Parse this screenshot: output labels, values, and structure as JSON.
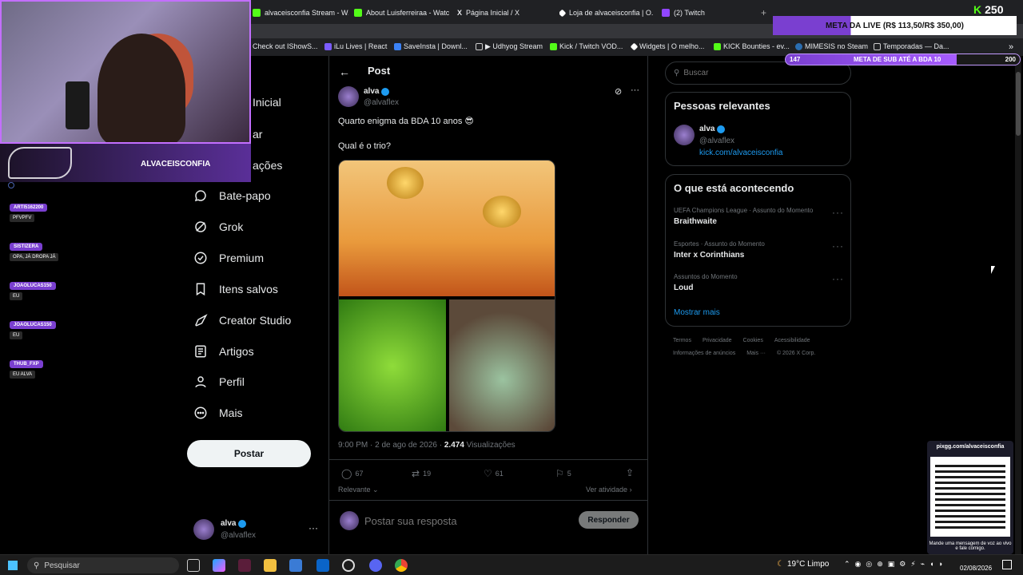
{
  "browser": {
    "tabs": [
      {
        "label": "alvaceisconfia Stream - W...",
        "color": "#53fc18"
      },
      {
        "label": "About Luisferreiraa - Watc...",
        "color": "#53fc18"
      },
      {
        "label": "Página Inicial / X",
        "color": "#ffffff"
      },
      {
        "label": "Loja de alvaceisconfia | O...",
        "color": "#ffffff"
      },
      {
        "label": "(2) Twitch",
        "color": "#9146ff"
      }
    ],
    "new_tab": "+",
    "bookmarks": [
      "Check out IShowS...",
      "iLu Lives | React",
      "SaveInsta | Downl...",
      "▶ Udhyog Stream",
      "Kick / Twitch VOD...",
      "Widgets | O melho...",
      "KICK Bounties - ev...",
      "MIMESIS no Steam",
      "Temporadas — Da..."
    ]
  },
  "overlay": {
    "kick_count": "250",
    "meta_live": "META DA LIVE (R$ 113,50/R$ 350,00)",
    "sub_left": "147",
    "sub_goal": "META DE SUB ATÉ A BDA 10",
    "sub_right": "200",
    "streamer_name": "ALVACEISCONFIA",
    "chat": [
      {
        "user": "ARTI5162200",
        "msg": "PFVPFV"
      },
      {
        "user": "SISTIZERA",
        "msg": "OPA, JÁ DROPA JÁ"
      },
      {
        "user": "JOAOLUCAS150",
        "msg": "EU"
      },
      {
        "user": "JOAOLUCAS150",
        "msg": "EU"
      },
      {
        "user": "THUB_FXP",
        "msg": "EU ALVA"
      }
    ],
    "pix_url": "pixgg.com/alvaceisconfia",
    "pix_caption": "Mande uma mensagem de voz ao vivo e fale comigo."
  },
  "nav": {
    "items": [
      {
        "label": "Inicial",
        "icon": "home-icon"
      },
      {
        "label": "ar",
        "icon": "search-icon"
      },
      {
        "label": "ações",
        "icon": "bell-icon"
      },
      {
        "label": "Bate-papo",
        "icon": "chat-icon"
      },
      {
        "label": "Grok",
        "icon": "grok-icon"
      },
      {
        "label": "Premium",
        "icon": "premium-icon"
      },
      {
        "label": "Itens salvos",
        "icon": "bookmark-icon"
      },
      {
        "label": "Creator Studio",
        "icon": "rocket-icon"
      },
      {
        "label": "Artigos",
        "icon": "article-icon"
      },
      {
        "label": "Perfil",
        "icon": "person-icon"
      },
      {
        "label": "Mais",
        "icon": "more-icon"
      }
    ],
    "post_button": "Postar",
    "account_name": "alva",
    "account_handle": "@alvaflex"
  },
  "post": {
    "header": "Post",
    "author_name": "alva",
    "author_handle": "@alvaflex",
    "text_line1": "Quarto enigma da BDA 10 anos 😎",
    "text_line2": "Qual é o trio?",
    "timestamp": "9:00 PM · 2 de ago de 2026 · ",
    "views_count": "2.474",
    "views_label": " Visualizações",
    "replies": "67",
    "reposts": "19",
    "likes": "61",
    "bookmarks": "5",
    "sort_label": "Relevante",
    "activity_label": "Ver atividade",
    "reply_placeholder": "Postar sua resposta",
    "reply_button": "Responder"
  },
  "sidebar": {
    "search_placeholder": "Buscar",
    "relevant_title": "Pessoas relevantes",
    "relevant_name": "alva",
    "relevant_handle": "@alvaflex",
    "relevant_link": "kick.com/alvaceisconfia",
    "trending_title": "O que está acontecendo",
    "trends": [
      {
        "context": "UEFA Champions League · Assunto do Momento",
        "name": "Braithwaite"
      },
      {
        "context": "Esportes · Assunto do Momento",
        "name": "Inter x Corinthians"
      },
      {
        "context": "Assuntos do Momento",
        "name": "Loud"
      }
    ],
    "show_more": "Mostrar mais",
    "footer_row1": [
      "Termos",
      "Privacidade",
      "Cookies",
      "Acessibilidade"
    ],
    "footer_row2": [
      "Informações de anúncios",
      "Mais ···",
      "© 2026 X Corp."
    ]
  },
  "taskbar": {
    "search": "Pesquisar",
    "weather": "19°C  Limpo",
    "date": "02/08/2026"
  }
}
